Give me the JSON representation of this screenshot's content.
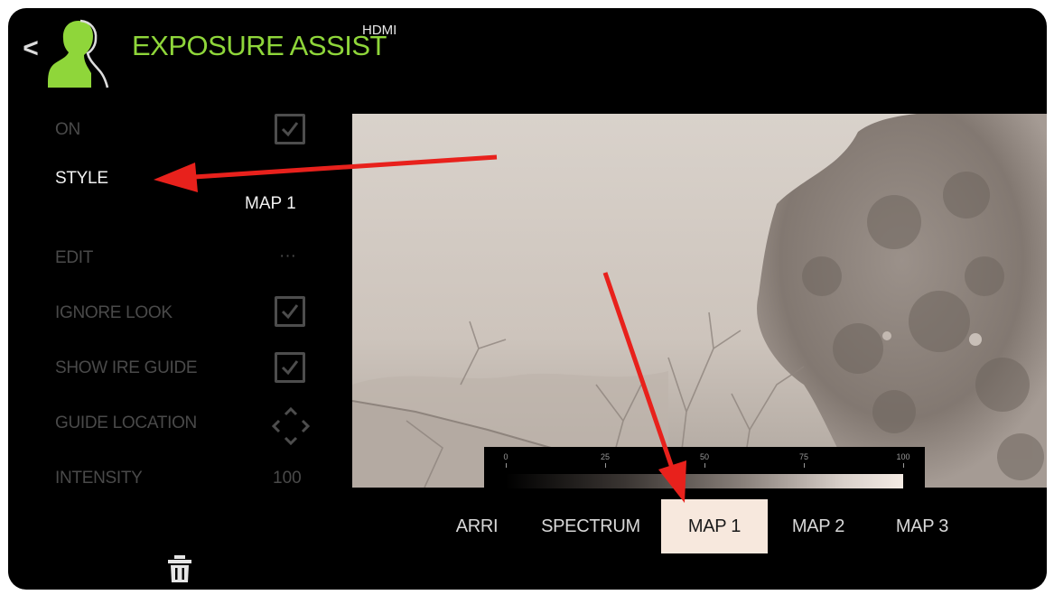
{
  "header": {
    "title": "EXPOSURE ASSIST",
    "subtitle": "HDMI",
    "back_label": "<"
  },
  "sidebar": {
    "on": {
      "label": "ON",
      "checked": true
    },
    "style": {
      "label": "STYLE",
      "value": "MAP 1"
    },
    "edit": {
      "label": "EDIT",
      "value": "···"
    },
    "ignore_look": {
      "label": "IGNORE LOOK",
      "checked": true
    },
    "show_ire_guide": {
      "label": "SHOW IRE GUIDE",
      "checked": true
    },
    "guide_location": {
      "label": "GUIDE LOCATION",
      "icon": "dpad-icon"
    },
    "intensity": {
      "label": "INTENSITY",
      "value": "100"
    },
    "delete_icon": "trash-icon"
  },
  "ire_guide": {
    "ticks": [
      "0",
      "25",
      "50",
      "75",
      "100"
    ]
  },
  "style_tabs": {
    "items": [
      "ARRI",
      "SPECTRUM",
      "MAP 1",
      "MAP 2",
      "MAP 3"
    ],
    "selected": "MAP 1"
  },
  "colors": {
    "accent_green": "#8fd63a",
    "selected_tab_bg": "#f7e8dd",
    "annotation_arrow": "#e8211c",
    "inactive_text": "#4a4a4a",
    "active_text": "#f2f2f2"
  }
}
